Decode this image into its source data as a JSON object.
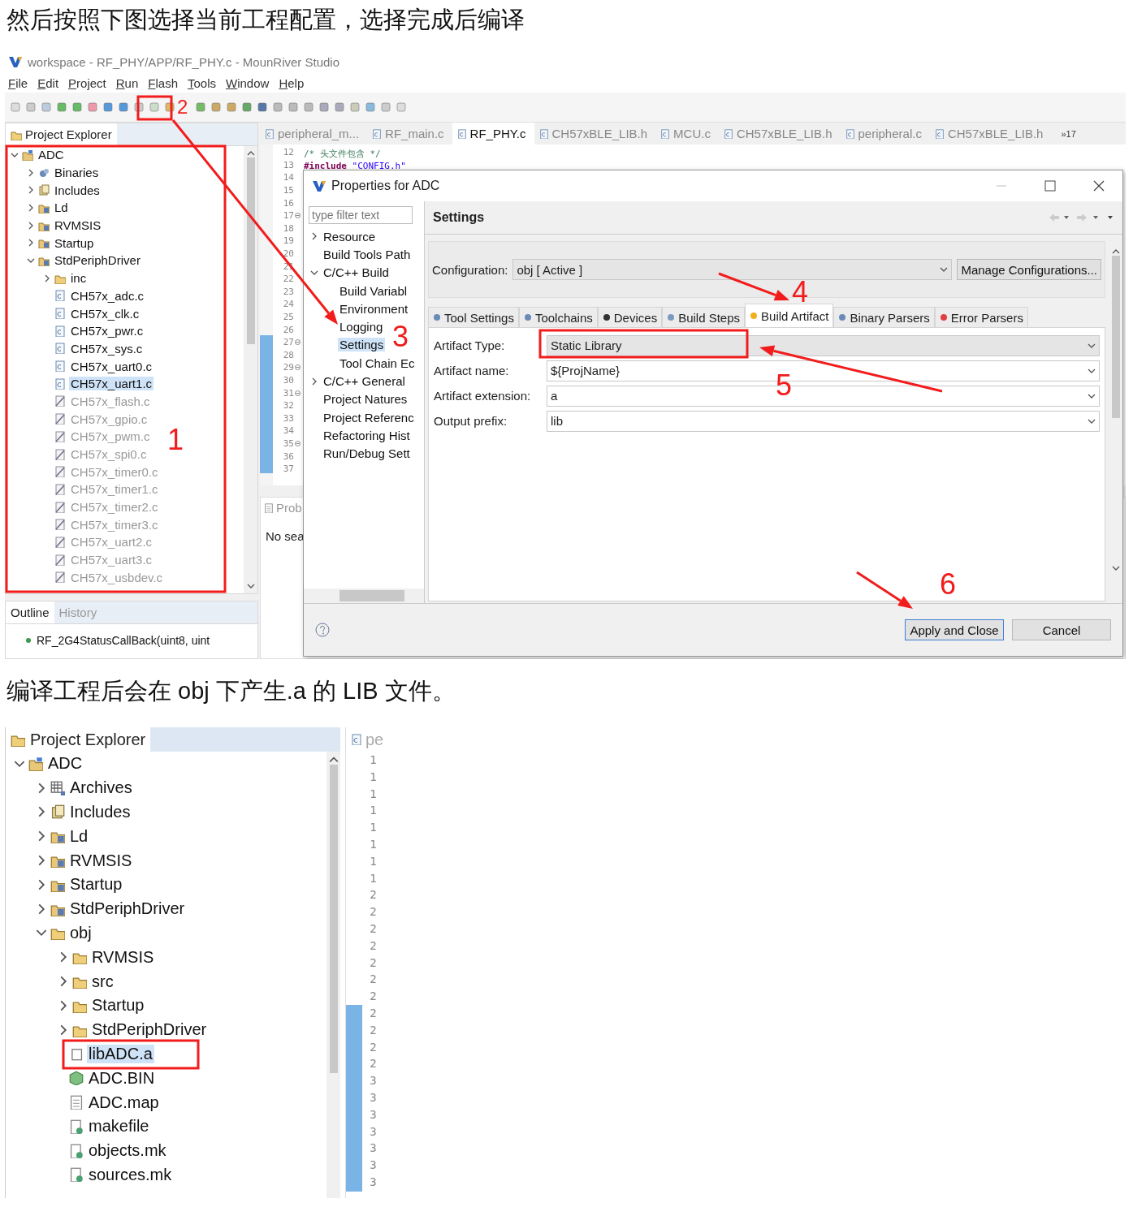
{
  "heading_1": "然后按照下图选择当前工程配置，选择完成后编译",
  "ide": {
    "window_title": "workspace - RF_PHY/APP/RF_PHY.c - MounRiver Studio",
    "menu": [
      {
        "label": "File"
      },
      {
        "label": "Edit"
      },
      {
        "label": "Project"
      },
      {
        "label": "Run"
      },
      {
        "label": "Flash"
      },
      {
        "label": "Tools"
      },
      {
        "label": "Window"
      },
      {
        "label": "Help"
      }
    ],
    "explorer": {
      "title": "Project Explorer",
      "tree": [
        {
          "label": "ADC",
          "kind": "project",
          "expanded": true,
          "selected": false,
          "children": [
            {
              "label": "Binaries",
              "kind": "binaries",
              "expanded": false,
              "selected": false
            },
            {
              "label": "Includes",
              "kind": "includes",
              "expanded": false,
              "selected": false
            },
            {
              "label": "Ld",
              "kind": "source-folder",
              "expanded": false,
              "selected": false
            },
            {
              "label": "RVMSIS",
              "kind": "source-folder",
              "expanded": false,
              "selected": false
            },
            {
              "label": "Startup",
              "kind": "source-folder",
              "expanded": false,
              "selected": false
            },
            {
              "label": "StdPeriphDriver",
              "kind": "source-folder",
              "expanded": true,
              "selected": false,
              "children": [
                {
                  "label": "inc",
                  "kind": "folder",
                  "expanded": false,
                  "selected": false
                },
                {
                  "label": "CH57x_adc.c",
                  "kind": "c-file",
                  "selected": false
                },
                {
                  "label": "CH57x_clk.c",
                  "kind": "c-file",
                  "selected": false
                },
                {
                  "label": "CH57x_pwr.c",
                  "kind": "c-file",
                  "selected": false
                },
                {
                  "label": "CH57x_sys.c",
                  "kind": "c-file",
                  "selected": false
                },
                {
                  "label": "CH57x_uart0.c",
                  "kind": "c-file",
                  "selected": false
                },
                {
                  "label": "CH57x_uart1.c",
                  "kind": "c-file",
                  "selected": true
                },
                {
                  "label": "CH57x_flash.c",
                  "kind": "excluded-file",
                  "selected": false
                },
                {
                  "label": "CH57x_gpio.c",
                  "kind": "excluded-file",
                  "selected": false
                },
                {
                  "label": "CH57x_pwm.c",
                  "kind": "excluded-file",
                  "selected": false
                },
                {
                  "label": "CH57x_spi0.c",
                  "kind": "excluded-file",
                  "selected": false
                },
                {
                  "label": "CH57x_timer0.c",
                  "kind": "excluded-file",
                  "selected": false
                },
                {
                  "label": "CH57x_timer1.c",
                  "kind": "excluded-file",
                  "selected": false
                },
                {
                  "label": "CH57x_timer2.c",
                  "kind": "excluded-file",
                  "selected": false
                },
                {
                  "label": "CH57x_timer3.c",
                  "kind": "excluded-file",
                  "selected": false
                },
                {
                  "label": "CH57x_uart2.c",
                  "kind": "excluded-file",
                  "selected": false
                },
                {
                  "label": "CH57x_uart3.c",
                  "kind": "excluded-file",
                  "selected": false
                },
                {
                  "label": "CH57x_usbdev.c",
                  "kind": "excluded-file",
                  "selected": false
                }
              ]
            }
          ]
        }
      ]
    },
    "outline": {
      "tabs": [
        {
          "label": "Outline",
          "selected": true
        },
        {
          "label": "History",
          "selected": false
        }
      ],
      "items": [
        "RF_2G4StatusCallBack(uint8, uint"
      ]
    },
    "editor_tabs": [
      {
        "label": "peripheral_m...",
        "selected": false
      },
      {
        "label": "RF_main.c",
        "selected": false
      },
      {
        "label": "RF_PHY.c",
        "selected": true
      },
      {
        "label": "CH57xBLE_LIB.h",
        "selected": false
      },
      {
        "label": "MCU.c",
        "selected": false
      },
      {
        "label": "CH57xBLE_LIB.h",
        "selected": false
      },
      {
        "label": "peripheral.c",
        "selected": false
      },
      {
        "label": "CH57xBLE_LIB.h",
        "selected": false
      }
    ],
    "tab_overflow": "»17",
    "code_lines": [
      {
        "number": "12",
        "fold": false,
        "tokens": [
          {
            "kind": "comment",
            "text": "/* 头文件包含 */"
          }
        ]
      },
      {
        "number": "13",
        "fold": false,
        "tokens": [
          {
            "kind": "directive",
            "text": "#include"
          },
          {
            "kind": "string",
            "text": " \"CONFIG.h\""
          }
        ]
      },
      {
        "number": "14",
        "fold": false
      },
      {
        "number": "15",
        "fold": false
      },
      {
        "number": "16",
        "fold": false
      },
      {
        "number": "17",
        "fold": true
      },
      {
        "number": "18",
        "fold": false
      },
      {
        "number": "19",
        "fold": false
      },
      {
        "number": "20",
        "fold": false
      },
      {
        "number": "21",
        "fold": false
      },
      {
        "number": "22",
        "fold": false
      },
      {
        "number": "23",
        "fold": false
      },
      {
        "number": "24",
        "fold": false
      },
      {
        "number": "25",
        "fold": false
      },
      {
        "number": "26",
        "fold": false
      },
      {
        "number": "27",
        "fold": true
      },
      {
        "number": "28",
        "fold": false
      },
      {
        "number": "29",
        "fold": true
      },
      {
        "number": "30",
        "fold": false
      },
      {
        "number": "31",
        "fold": true
      },
      {
        "number": "32",
        "fold": false
      },
      {
        "number": "33",
        "fold": false
      },
      {
        "number": "34",
        "fold": false
      },
      {
        "number": "35",
        "fold": true
      },
      {
        "number": "36",
        "fold": false
      },
      {
        "number": "37",
        "fold": false
      }
    ],
    "problems": {
      "tab": "Prob",
      "message": "No sea"
    },
    "dialog": {
      "title": "Properties for ADC",
      "filter_placeholder": "type filter text",
      "nav": [
        {
          "label": "Resource",
          "expanded": false,
          "selected": false
        },
        {
          "label": "Build Tools Path",
          "selected": false
        },
        {
          "label": "C/C++ Build",
          "expanded": true,
          "selected": false,
          "children": [
            {
              "label": "Build Variabl",
              "selected": false
            },
            {
              "label": "Environment",
              "selected": false
            },
            {
              "label": "Logging",
              "selected": false
            },
            {
              "label": "Settings",
              "selected": true
            },
            {
              "label": "Tool Chain Ec",
              "selected": false
            }
          ]
        },
        {
          "label": "C/C++ General",
          "expanded": false,
          "selected": false
        },
        {
          "label": "Project Natures",
          "selected": false
        },
        {
          "label": "Project Referenc",
          "selected": false
        },
        {
          "label": "Refactoring Hist",
          "selected": false
        },
        {
          "label": "Run/Debug Sett",
          "selected": false
        }
      ],
      "page_title": "Settings",
      "configuration_label": "Configuration:",
      "configuration_value": "obj  [ Active ]",
      "manage_button": "Manage Configurations...",
      "tabs": [
        {
          "label": "Tool Settings",
          "selected": false
        },
        {
          "label": "Toolchains",
          "selected": false
        },
        {
          "label": "Devices",
          "selected": false
        },
        {
          "label": "Build Steps",
          "selected": false
        },
        {
          "label": "Build Artifact",
          "selected": true
        },
        {
          "label": "Binary Parsers",
          "selected": false
        },
        {
          "label": "Error Parsers",
          "selected": false
        }
      ],
      "fields": [
        {
          "label": "Artifact Type:",
          "value": "Static Library",
          "kind": "readonly"
        },
        {
          "label": "Artifact name:",
          "value": "${ProjName}",
          "kind": "editable"
        },
        {
          "label": "Artifact extension:",
          "value": "a",
          "kind": "editable"
        },
        {
          "label": "Output prefix:",
          "value": "lib",
          "kind": "editable"
        }
      ],
      "buttons": [
        {
          "label": "Apply and Close",
          "default": true
        },
        {
          "label": "Cancel",
          "default": false
        }
      ]
    },
    "step_numbers": [
      "1",
      "2",
      "3",
      "4",
      "5",
      "6"
    ]
  },
  "heading_2": "编译工程后会在 obj 下产生.a 的 LIB 文件。",
  "result": {
    "title": "Project Explorer",
    "editor_tab": "pe",
    "tree": [
      {
        "label": "ADC",
        "kind": "project",
        "expanded": true,
        "selected": false,
        "children": [
          {
            "label": "Archives",
            "kind": "archives",
            "expanded": false,
            "selected": false
          },
          {
            "label": "Includes",
            "kind": "includes",
            "expanded": false,
            "selected": false
          },
          {
            "label": "Ld",
            "kind": "source-folder",
            "expanded": false,
            "selected": false
          },
          {
            "label": "RVMSIS",
            "kind": "source-folder",
            "expanded": false,
            "selected": false
          },
          {
            "label": "Startup",
            "kind": "source-folder",
            "expanded": false,
            "selected": false
          },
          {
            "label": "StdPeriphDriver",
            "kind": "source-folder",
            "expanded": false,
            "selected": false
          },
          {
            "label": "obj",
            "kind": "folder",
            "expanded": true,
            "selected": false,
            "children": [
              {
                "label": "RVMSIS",
                "kind": "folder",
                "expanded": false,
                "selected": false
              },
              {
                "label": "src",
                "kind": "folder",
                "expanded": false,
                "selected": false
              },
              {
                "label": "Startup",
                "kind": "folder",
                "expanded": false,
                "selected": false
              },
              {
                "label": "StdPeriphDriver",
                "kind": "folder",
                "expanded": false,
                "selected": false
              },
              {
                "label": "libADC.a",
                "kind": "lib-file",
                "selected": true
              },
              {
                "label": "ADC.BIN",
                "kind": "hex-file",
                "selected": false
              },
              {
                "label": "ADC.map",
                "kind": "text-file",
                "selected": false
              },
              {
                "label": "makefile",
                "kind": "make-file",
                "selected": false
              },
              {
                "label": "objects.mk",
                "kind": "make-file",
                "selected": false
              },
              {
                "label": "sources.mk",
                "kind": "make-file",
                "selected": false
              }
            ]
          }
        ]
      }
    ],
    "line_numbers": [
      "1",
      "1",
      "1",
      "1",
      "1",
      "1",
      "1",
      "1",
      "2",
      "2",
      "2",
      "2",
      "2",
      "2",
      "2",
      "2",
      "2",
      "2",
      "2",
      "3",
      "3",
      "3",
      "3",
      "3",
      "3",
      "3"
    ]
  }
}
